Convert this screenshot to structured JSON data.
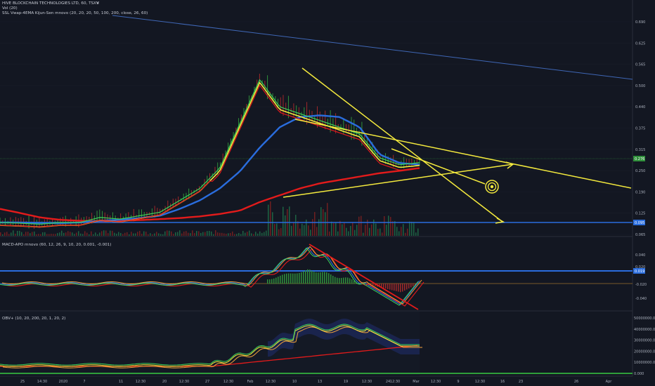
{
  "header": {
    "symbol_line": "HIVE BLOCKCHAIN TECHNOLOGIES LTD, 60, TSXV",
    "close_glyph": "✕",
    "indicator_1": "Vol (20)",
    "indicator_2": "SSL Vwap-4EMA Kijun-Sen mnovo (20, 20, 20, 50, 100, 200, close, 26, 60)"
  },
  "colors": {
    "background": "#131722",
    "grid": "#1e2230",
    "yellow": "#f4ea3d",
    "green": "#3dd35a",
    "red": "#e31b1b",
    "blue": "#2a6dde",
    "trendline_blue": "#3f67b6",
    "candle_up": "#2f8f3a",
    "candle_down": "#a0282a",
    "panel_border": "#2a2e39"
  },
  "price_panel": {
    "y_ticks": [
      "0.690",
      "0.625",
      "0.565",
      "0.500",
      "0.440",
      "0.375",
      "0.315",
      "0.250",
      "0.190",
      "0.125",
      "0.065"
    ],
    "current_price": "0.276",
    "support_label": "0.095"
  },
  "macd_panel": {
    "title": "MACD-APO mnovo (60, 12, 26, 9, 10, 20, 0.001, -0.001)",
    "y_ticks": [
      "0.040",
      "0.020",
      "-0.020",
      "-0.040"
    ],
    "highlight_value": "0.019"
  },
  "obv_panel": {
    "title": "OBV+ (10, 20, 200, 20, 1, 20, 2)",
    "y_ticks": [
      "50000000.000",
      "40000000.000",
      "30000000.000",
      "20000000.000",
      "10000000.000",
      "0.000"
    ]
  },
  "time_axis": {
    "labels": [
      "25",
      "14:30",
      "2020",
      "7",
      "11",
      "12:30",
      "20",
      "12:30",
      "27",
      "12:30",
      "Feb",
      "12:30",
      "10",
      "13",
      "19",
      "12:30",
      "24",
      "12:30",
      "Mar",
      "12:30",
      "9",
      "12:30",
      "16",
      "23",
      "26",
      "Apr"
    ]
  },
  "chart_data": {
    "type": "line",
    "title": "HIVE BLOCKCHAIN TECHNOLOGIES LTD, 60, TSXV",
    "ylim": [
      0.065,
      0.69
    ],
    "series": [
      {
        "name": "price",
        "values": [
          0.1,
          0.098,
          0.095,
          0.1,
          0.1,
          0.115,
          0.11,
          0.12,
          0.13,
          0.165,
          0.2,
          0.26,
          0.39,
          0.52,
          0.44,
          0.42,
          0.4,
          0.38,
          0.36,
          0.29,
          0.27,
          0.276
        ]
      },
      {
        "name": "ema_200",
        "values": [
          0.14,
          0.128,
          0.115,
          0.108,
          0.105,
          0.104,
          0.105,
          0.107,
          0.11,
          0.113,
          0.118,
          0.125,
          0.135,
          0.16,
          0.18,
          0.2,
          0.215,
          0.225,
          0.235,
          0.245,
          0.252,
          0.26
        ]
      },
      {
        "name": "ema_50",
        "values": [
          0.1,
          0.1,
          0.099,
          0.098,
          0.1,
          0.105,
          0.108,
          0.113,
          0.12,
          0.14,
          0.165,
          0.2,
          0.25,
          0.32,
          0.38,
          0.41,
          0.415,
          0.41,
          0.38,
          0.3,
          0.275,
          0.27
        ]
      }
    ]
  }
}
